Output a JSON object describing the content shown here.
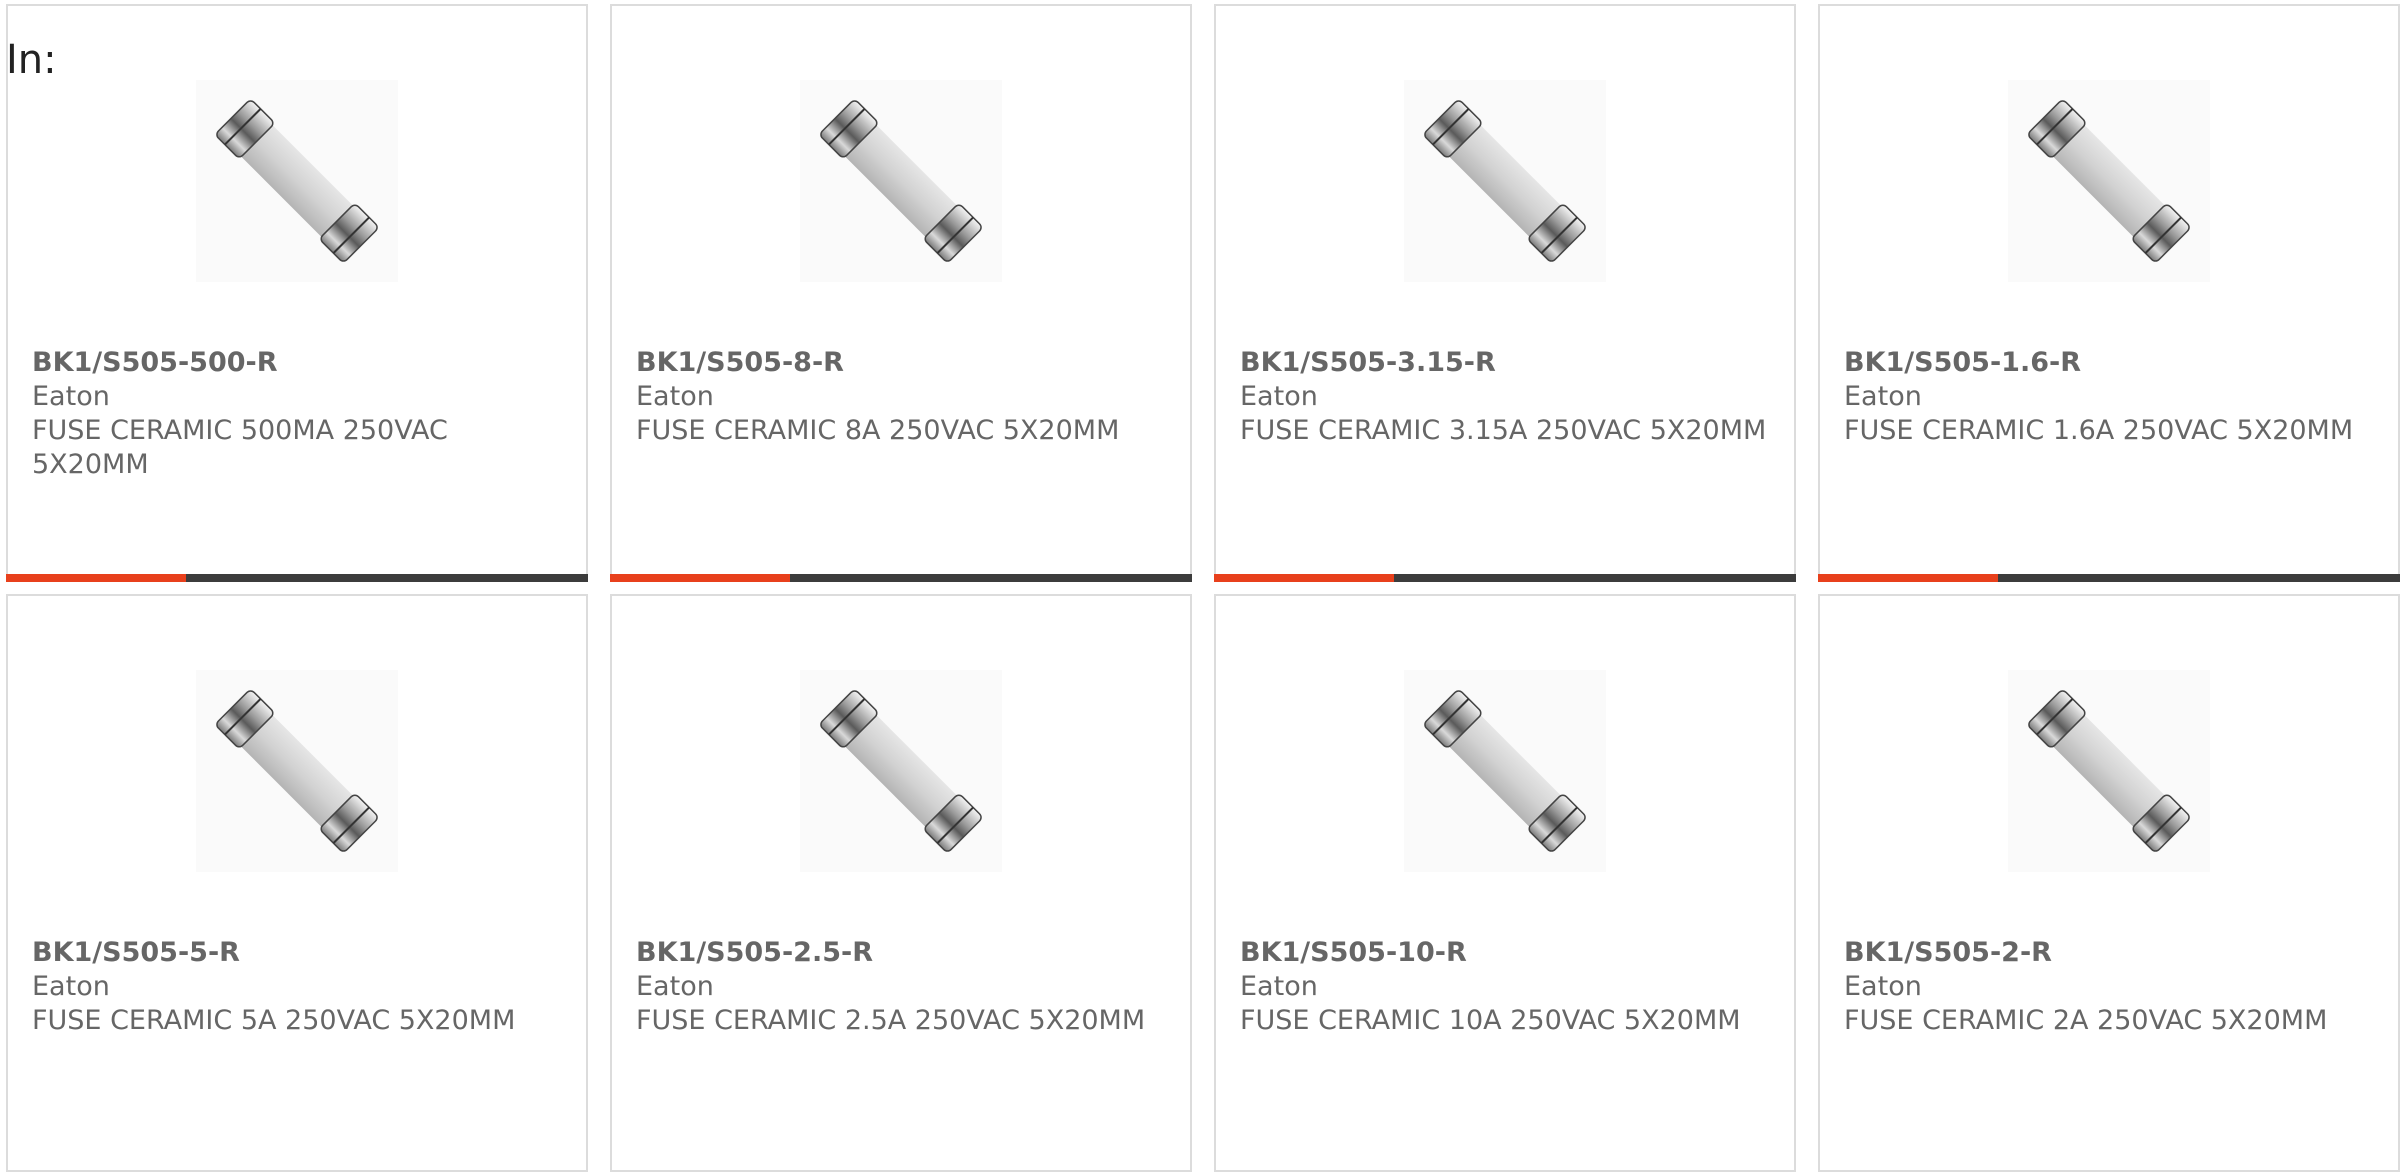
{
  "header": {
    "label": "In:"
  },
  "colors": {
    "accent": "#e8401c",
    "bar_track": "#3c3c3c",
    "text": "#666666",
    "border": "#dcdcdc"
  },
  "products": [
    {
      "part": "BK1/S505-500-R",
      "mfr": "Eaton",
      "desc": "FUSE CERAMIC 500MA 250VAC 5X20MM",
      "image": "fuse-image",
      "bar_fraction": 0.31
    },
    {
      "part": "BK1/S505-8-R",
      "mfr": "Eaton",
      "desc": "FUSE CERAMIC 8A 250VAC 5X20MM",
      "image": "fuse-image",
      "bar_fraction": 0.31
    },
    {
      "part": "BK1/S505-3.15-R",
      "mfr": "Eaton",
      "desc": "FUSE CERAMIC 3.15A 250VAC 5X20MM",
      "image": "fuse-image",
      "bar_fraction": 0.31
    },
    {
      "part": "BK1/S505-1.6-R",
      "mfr": "Eaton",
      "desc": "FUSE CERAMIC 1.6A 250VAC 5X20MM",
      "image": "fuse-image",
      "bar_fraction": 0.31
    },
    {
      "part": "BK1/S505-5-R",
      "mfr": "Eaton",
      "desc": "FUSE CERAMIC 5A 250VAC 5X20MM",
      "image": "fuse-image"
    },
    {
      "part": "BK1/S505-2.5-R",
      "mfr": "Eaton",
      "desc": "FUSE CERAMIC 2.5A 250VAC 5X20MM",
      "image": "fuse-image"
    },
    {
      "part": "BK1/S505-10-R",
      "mfr": "Eaton",
      "desc": "FUSE CERAMIC 10A 250VAC 5X20MM",
      "image": "fuse-image"
    },
    {
      "part": "BK1/S505-2-R",
      "mfr": "Eaton",
      "desc": "FUSE CERAMIC 2A 250VAC 5X20MM",
      "image": "fuse-image"
    }
  ]
}
